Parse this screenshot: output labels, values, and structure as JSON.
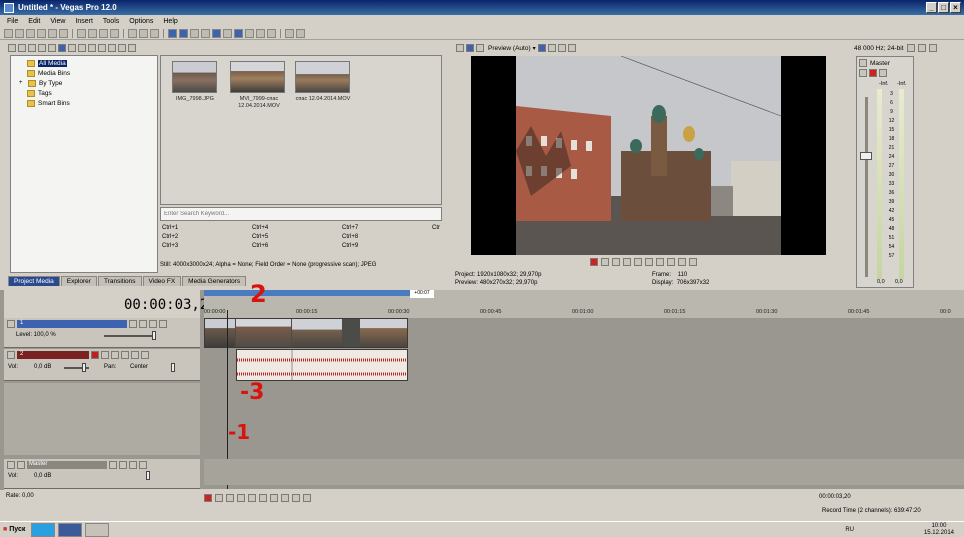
{
  "window": {
    "title": "Untitled * - Vegas Pro 12.0"
  },
  "menu": [
    "File",
    "Edit",
    "View",
    "Insert",
    "Tools",
    "Options",
    "Help"
  ],
  "explorer": {
    "tree": [
      "All Media",
      "Media Bins",
      "By Type",
      "Tags",
      "Smart Bins"
    ],
    "media": [
      {
        "name": "IMG_7998.JPG"
      },
      {
        "name": "MVI_7999-спас 12.04.2014.MOV"
      },
      {
        "name": "спас 12.04.2014.MOV"
      }
    ],
    "search_placeholder": "Enter Search Keyword...",
    "tags": [
      "Ctrl+1",
      "Ctrl+4",
      "Ctrl+7",
      "Ctrl+2",
      "Ctrl+5",
      "Ctrl+8",
      "Ctrl+3",
      "Ctrl+6",
      "Ctrl+9",
      "Ctr"
    ],
    "info": "Still: 4000x3000x24; Alpha = None; Field Order = None (progressive scan); JPEG",
    "tabs": [
      "Project Media",
      "Explorer",
      "Transitions",
      "Video FX",
      "Media Generators"
    ]
  },
  "preview": {
    "mode": "Preview (Auto)",
    "project_label": "Project:",
    "project_value": "1920x1080x32; 29,970p",
    "preview_label": "Preview:",
    "preview_value": "480x270x32; 29,970p",
    "frame_label": "Frame:",
    "frame_value": "110",
    "display_label": "Display:",
    "display_value": "706x397x32"
  },
  "mixer": {
    "format": "48 000 Hz; 24-bit",
    "master": "Master",
    "inf_left": "-Inf.",
    "inf_right": "-Inf.",
    "scale": [
      "3",
      "6",
      "9",
      "12",
      "15",
      "18",
      "21",
      "24",
      "27",
      "30",
      "33",
      "36",
      "39",
      "42",
      "45",
      "48",
      "51",
      "54",
      "57"
    ],
    "bottom_left": "0,0",
    "bottom_right": "0,0"
  },
  "timeline": {
    "timecode": "00:00:03,20",
    "region_end": "+00:07",
    "ruler": [
      "00:00:00",
      "00:00:15",
      "00:00:30",
      "00:00:45",
      "00:01:00",
      "00:01:15",
      "00:01:30",
      "00:01:45",
      "00:0"
    ],
    "video_track": {
      "number": "1",
      "level_label": "Level: 100,0 %"
    },
    "audio_track": {
      "number": "2",
      "vol_label": "Vol:",
      "vol_value": "0,0 dB",
      "pan_label": "Pan:",
      "pan_value": "Center"
    },
    "master": {
      "label": "Master",
      "vol_label": "Vol:",
      "vol_value": "0,0 dB"
    },
    "rate_label": "Rate: 0,00",
    "transport_time": "00:00:03,20",
    "record_time": "Record Time (2 channels): 639:47:20"
  },
  "annotations": {
    "mark1": "-1",
    "mark2": "2",
    "mark3": "-3"
  },
  "taskbar": {
    "start": "Пуск",
    "lang": "RU",
    "clock_time": "10:00",
    "clock_date": "15.12.2014"
  }
}
